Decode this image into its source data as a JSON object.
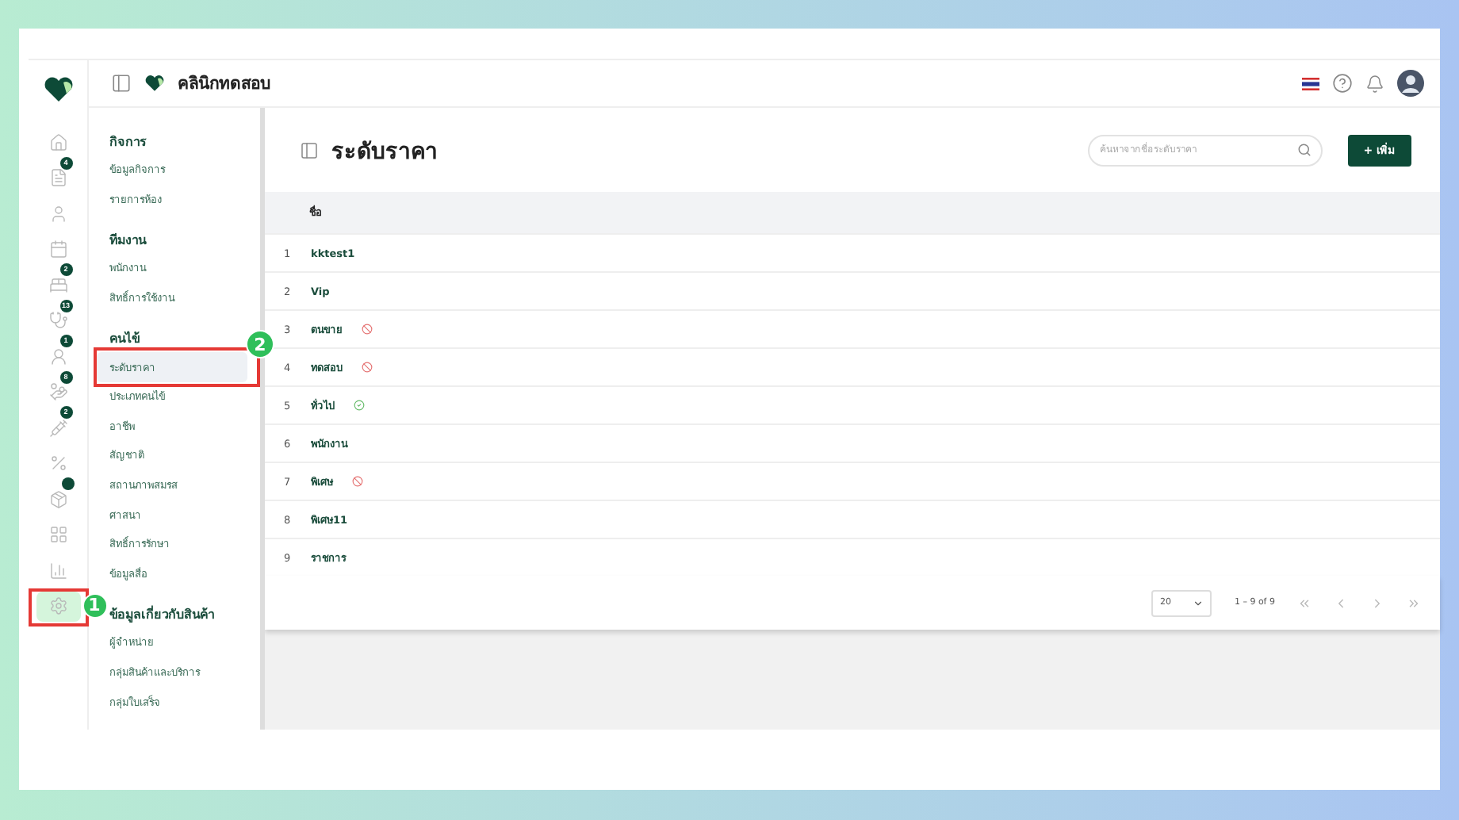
{
  "app": {
    "clinic_name": "คลินิกทดสอบ"
  },
  "rail": [
    {
      "selected": false
    },
    {
      "badge": "4",
      "selected": false
    },
    {
      "selected": false
    },
    {
      "selected": false
    },
    {
      "badge": "2",
      "selected": false
    },
    {
      "badge": "13",
      "selected": false
    },
    {
      "badge": "1",
      "selected": false
    },
    {
      "badge": "8",
      "selected": false
    },
    {
      "badge": "2",
      "selected": false
    },
    {
      "selected": false
    },
    {
      "dot": true,
      "selected": false
    },
    {
      "selected": false
    },
    {
      "selected": false
    },
    {
      "selected": true,
      "step": "1"
    }
  ],
  "submenu": [
    {
      "title": "กิจการ",
      "items": [
        {
          "label": "ข้อมูลกิจการ",
          "selected": false
        },
        {
          "label": "รายการห้อง",
          "selected": false
        }
      ]
    },
    {
      "title": "ทีมงาน",
      "items": [
        {
          "label": "พนักงาน",
          "selected": false
        },
        {
          "label": "สิทธิ์การใช้งาน",
          "selected": false
        }
      ]
    },
    {
      "title": "คนไข้",
      "items": [
        {
          "label": "ระดับราคา",
          "selected": true,
          "step": "2"
        },
        {
          "label": "ประเภทคนไข้",
          "selected": false
        },
        {
          "label": "อาชีพ",
          "selected": false
        },
        {
          "label": "สัญชาติ",
          "selected": false
        },
        {
          "label": "สถานภาพสมรส",
          "selected": false
        },
        {
          "label": "ศาสนา",
          "selected": false
        },
        {
          "label": "สิทธิ์การรักษา",
          "selected": false
        },
        {
          "label": "ข้อมูลสื่อ",
          "selected": false
        }
      ]
    },
    {
      "title": "ข้อมูลเกี่ยวกับสินค้า",
      "items": [
        {
          "label": "ผู้จำหน่าย",
          "selected": false
        },
        {
          "label": "กลุ่มสินค้าและบริการ",
          "selected": false
        },
        {
          "label": "กลุ่มใบเสร็จ",
          "selected": false
        }
      ]
    }
  ],
  "page": {
    "title": "ระดับราคา",
    "search": {
      "placeholder": "ค้นหาจากชื่อระดับราคา"
    },
    "add_button": "+ เพิ่ม"
  },
  "table": {
    "columns": [
      "ชื่อ"
    ],
    "rows": [
      {
        "index": "1",
        "name": "kktest1",
        "kind": "plain"
      },
      {
        "index": "2",
        "name": "Vip",
        "kind": "plain"
      },
      {
        "index": "3",
        "name": "ตนขาย",
        "kind": "disabled"
      },
      {
        "index": "4",
        "name": "ทดสอบ",
        "kind": "disabled"
      },
      {
        "index": "5",
        "name": "ทั่วไป",
        "kind": "enabled"
      },
      {
        "index": "6",
        "name": "พนักงาน",
        "kind": "plain"
      },
      {
        "index": "7",
        "name": "พิเศษ",
        "kind": "disabled"
      },
      {
        "index": "8",
        "name": "พิเศษ11",
        "kind": "plain"
      },
      {
        "index": "9",
        "name": "ราชการ",
        "kind": "plain"
      }
    ]
  },
  "pagination": {
    "page_size": "20",
    "range": "1 – 9 of 9"
  }
}
